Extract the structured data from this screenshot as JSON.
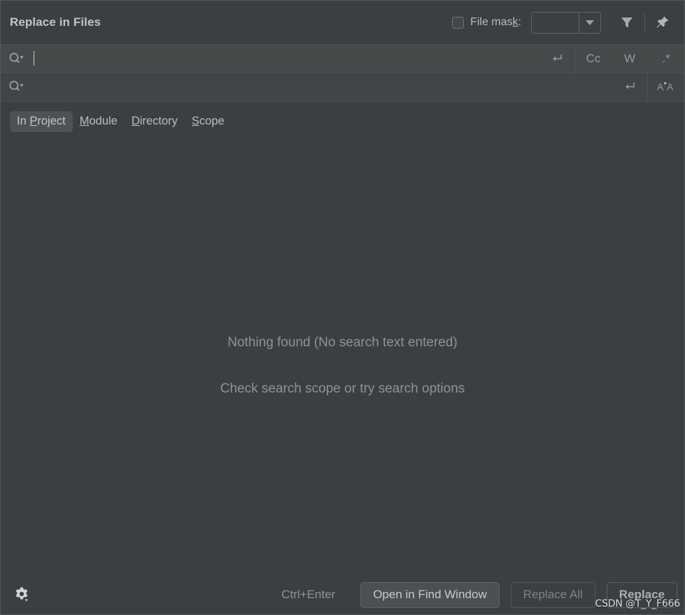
{
  "window": {
    "title": "Replace in Files"
  },
  "header": {
    "file_mask": {
      "checkbox_checked": false,
      "label_pre": "File mas",
      "label_mnemonic": "k",
      "label_post": ":",
      "combo_value": "",
      "combo_placeholder": ""
    },
    "filter_icon": "filter-funnel-icon",
    "pin_icon": "pin-icon"
  },
  "search": {
    "find_row": {
      "icon": "search-dropdown-icon",
      "value": "",
      "placeholder": "",
      "new_line_icon": "insert-new-line-icon",
      "options": [
        {
          "id": "match-case",
          "label": "Cc"
        },
        {
          "id": "words",
          "label": "W"
        },
        {
          "id": "regex",
          "label": ".*"
        }
      ]
    },
    "replace_row": {
      "icon": "search-dropdown-icon",
      "value": "",
      "placeholder": "",
      "new_line_icon": "insert-new-line-icon",
      "preserve_case_icon": "preserve-case-icon"
    }
  },
  "scope": {
    "tabs": [
      {
        "id": "in-project",
        "pre": "In ",
        "mnemonic": "P",
        "post": "roject",
        "active": true
      },
      {
        "id": "module",
        "pre": "",
        "mnemonic": "M",
        "post": "odule",
        "active": false
      },
      {
        "id": "directory",
        "pre": "",
        "mnemonic": "D",
        "post": "irectory",
        "active": false
      },
      {
        "id": "scope",
        "pre": "",
        "mnemonic": "S",
        "post": "cope",
        "active": false
      }
    ]
  },
  "results": {
    "empty_primary": "Nothing found (No search text entered)",
    "empty_secondary": "Check search scope or try search options"
  },
  "footer": {
    "settings_icon": "gear-dropdown-icon",
    "shortcut_hint": "Ctrl+Enter",
    "buttons": [
      {
        "id": "open-in-find-window",
        "label": "Open in Find Window",
        "state": "focused"
      },
      {
        "id": "replace-all",
        "label": "Replace All",
        "state": "disabled"
      },
      {
        "id": "replace",
        "label": "Replace",
        "state": "default"
      }
    ]
  },
  "watermark": {
    "text": "CSDN @T_Y_F666"
  },
  "colors": {
    "window_bg": "#3c3f41",
    "row_bg": "#45494a",
    "row_bg_alt": "#414547",
    "text": "#bbbbbb",
    "muted_text": "#8d9396",
    "border": "#55595b",
    "tab_active_bg": "#4e5254"
  }
}
